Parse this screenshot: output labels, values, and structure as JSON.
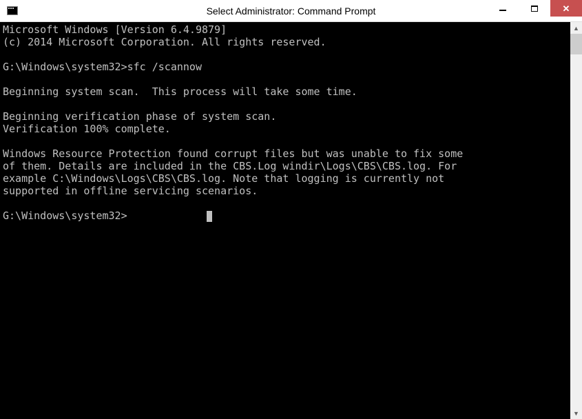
{
  "window": {
    "title": "Select Administrator: Command Prompt"
  },
  "console": {
    "l1": "Microsoft Windows [Version 6.4.9879]",
    "l2": "(c) 2014 Microsoft Corporation. All rights reserved.",
    "l3": "",
    "l4": "G:\\Windows\\system32>sfc /scannow",
    "l5": "",
    "l6": "Beginning system scan.  This process will take some time.",
    "l7": "",
    "l8": "Beginning verification phase of system scan.",
    "l9": "Verification 100% complete.",
    "l10": "",
    "l11": "Windows Resource Protection found corrupt files but was unable to fix some",
    "l12": "of them. Details are included in the CBS.Log windir\\Logs\\CBS\\CBS.log. For",
    "l13": "example C:\\Windows\\Logs\\CBS\\CBS.log. Note that logging is currently not",
    "l14": "supported in offline servicing scenarios.",
    "l15": "",
    "prompt": "G:\\Windows\\system32>"
  }
}
